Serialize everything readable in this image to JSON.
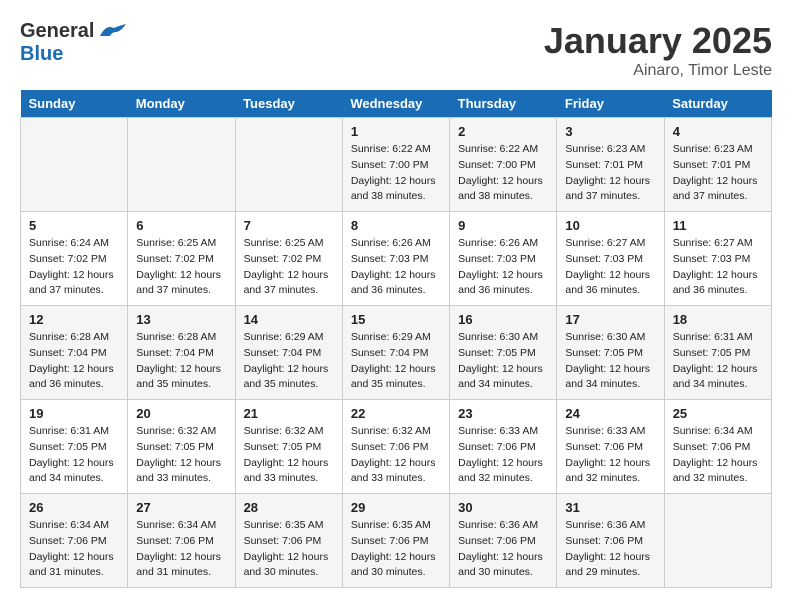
{
  "header": {
    "logo_general": "General",
    "logo_blue": "Blue",
    "month": "January 2025",
    "location": "Ainaro, Timor Leste"
  },
  "weekdays": [
    "Sunday",
    "Monday",
    "Tuesday",
    "Wednesday",
    "Thursday",
    "Friday",
    "Saturday"
  ],
  "weeks": [
    [
      {
        "day": "",
        "sunrise": "",
        "sunset": "",
        "daylight": ""
      },
      {
        "day": "",
        "sunrise": "",
        "sunset": "",
        "daylight": ""
      },
      {
        "day": "",
        "sunrise": "",
        "sunset": "",
        "daylight": ""
      },
      {
        "day": "1",
        "sunrise": "Sunrise: 6:22 AM",
        "sunset": "Sunset: 7:00 PM",
        "daylight": "Daylight: 12 hours and 38 minutes."
      },
      {
        "day": "2",
        "sunrise": "Sunrise: 6:22 AM",
        "sunset": "Sunset: 7:00 PM",
        "daylight": "Daylight: 12 hours and 38 minutes."
      },
      {
        "day": "3",
        "sunrise": "Sunrise: 6:23 AM",
        "sunset": "Sunset: 7:01 PM",
        "daylight": "Daylight: 12 hours and 37 minutes."
      },
      {
        "day": "4",
        "sunrise": "Sunrise: 6:23 AM",
        "sunset": "Sunset: 7:01 PM",
        "daylight": "Daylight: 12 hours and 37 minutes."
      }
    ],
    [
      {
        "day": "5",
        "sunrise": "Sunrise: 6:24 AM",
        "sunset": "Sunset: 7:02 PM",
        "daylight": "Daylight: 12 hours and 37 minutes."
      },
      {
        "day": "6",
        "sunrise": "Sunrise: 6:25 AM",
        "sunset": "Sunset: 7:02 PM",
        "daylight": "Daylight: 12 hours and 37 minutes."
      },
      {
        "day": "7",
        "sunrise": "Sunrise: 6:25 AM",
        "sunset": "Sunset: 7:02 PM",
        "daylight": "Daylight: 12 hours and 37 minutes."
      },
      {
        "day": "8",
        "sunrise": "Sunrise: 6:26 AM",
        "sunset": "Sunset: 7:03 PM",
        "daylight": "Daylight: 12 hours and 36 minutes."
      },
      {
        "day": "9",
        "sunrise": "Sunrise: 6:26 AM",
        "sunset": "Sunset: 7:03 PM",
        "daylight": "Daylight: 12 hours and 36 minutes."
      },
      {
        "day": "10",
        "sunrise": "Sunrise: 6:27 AM",
        "sunset": "Sunset: 7:03 PM",
        "daylight": "Daylight: 12 hours and 36 minutes."
      },
      {
        "day": "11",
        "sunrise": "Sunrise: 6:27 AM",
        "sunset": "Sunset: 7:03 PM",
        "daylight": "Daylight: 12 hours and 36 minutes."
      }
    ],
    [
      {
        "day": "12",
        "sunrise": "Sunrise: 6:28 AM",
        "sunset": "Sunset: 7:04 PM",
        "daylight": "Daylight: 12 hours and 36 minutes."
      },
      {
        "day": "13",
        "sunrise": "Sunrise: 6:28 AM",
        "sunset": "Sunset: 7:04 PM",
        "daylight": "Daylight: 12 hours and 35 minutes."
      },
      {
        "day": "14",
        "sunrise": "Sunrise: 6:29 AM",
        "sunset": "Sunset: 7:04 PM",
        "daylight": "Daylight: 12 hours and 35 minutes."
      },
      {
        "day": "15",
        "sunrise": "Sunrise: 6:29 AM",
        "sunset": "Sunset: 7:04 PM",
        "daylight": "Daylight: 12 hours and 35 minutes."
      },
      {
        "day": "16",
        "sunrise": "Sunrise: 6:30 AM",
        "sunset": "Sunset: 7:05 PM",
        "daylight": "Daylight: 12 hours and 34 minutes."
      },
      {
        "day": "17",
        "sunrise": "Sunrise: 6:30 AM",
        "sunset": "Sunset: 7:05 PM",
        "daylight": "Daylight: 12 hours and 34 minutes."
      },
      {
        "day": "18",
        "sunrise": "Sunrise: 6:31 AM",
        "sunset": "Sunset: 7:05 PM",
        "daylight": "Daylight: 12 hours and 34 minutes."
      }
    ],
    [
      {
        "day": "19",
        "sunrise": "Sunrise: 6:31 AM",
        "sunset": "Sunset: 7:05 PM",
        "daylight": "Daylight: 12 hours and 34 minutes."
      },
      {
        "day": "20",
        "sunrise": "Sunrise: 6:32 AM",
        "sunset": "Sunset: 7:05 PM",
        "daylight": "Daylight: 12 hours and 33 minutes."
      },
      {
        "day": "21",
        "sunrise": "Sunrise: 6:32 AM",
        "sunset": "Sunset: 7:05 PM",
        "daylight": "Daylight: 12 hours and 33 minutes."
      },
      {
        "day": "22",
        "sunrise": "Sunrise: 6:32 AM",
        "sunset": "Sunset: 7:06 PM",
        "daylight": "Daylight: 12 hours and 33 minutes."
      },
      {
        "day": "23",
        "sunrise": "Sunrise: 6:33 AM",
        "sunset": "Sunset: 7:06 PM",
        "daylight": "Daylight: 12 hours and 32 minutes."
      },
      {
        "day": "24",
        "sunrise": "Sunrise: 6:33 AM",
        "sunset": "Sunset: 7:06 PM",
        "daylight": "Daylight: 12 hours and 32 minutes."
      },
      {
        "day": "25",
        "sunrise": "Sunrise: 6:34 AM",
        "sunset": "Sunset: 7:06 PM",
        "daylight": "Daylight: 12 hours and 32 minutes."
      }
    ],
    [
      {
        "day": "26",
        "sunrise": "Sunrise: 6:34 AM",
        "sunset": "Sunset: 7:06 PM",
        "daylight": "Daylight: 12 hours and 31 minutes."
      },
      {
        "day": "27",
        "sunrise": "Sunrise: 6:34 AM",
        "sunset": "Sunset: 7:06 PM",
        "daylight": "Daylight: 12 hours and 31 minutes."
      },
      {
        "day": "28",
        "sunrise": "Sunrise: 6:35 AM",
        "sunset": "Sunset: 7:06 PM",
        "daylight": "Daylight: 12 hours and 30 minutes."
      },
      {
        "day": "29",
        "sunrise": "Sunrise: 6:35 AM",
        "sunset": "Sunset: 7:06 PM",
        "daylight": "Daylight: 12 hours and 30 minutes."
      },
      {
        "day": "30",
        "sunrise": "Sunrise: 6:36 AM",
        "sunset": "Sunset: 7:06 PM",
        "daylight": "Daylight: 12 hours and 30 minutes."
      },
      {
        "day": "31",
        "sunrise": "Sunrise: 6:36 AM",
        "sunset": "Sunset: 7:06 PM",
        "daylight": "Daylight: 12 hours and 29 minutes."
      },
      {
        "day": "",
        "sunrise": "",
        "sunset": "",
        "daylight": ""
      }
    ]
  ]
}
